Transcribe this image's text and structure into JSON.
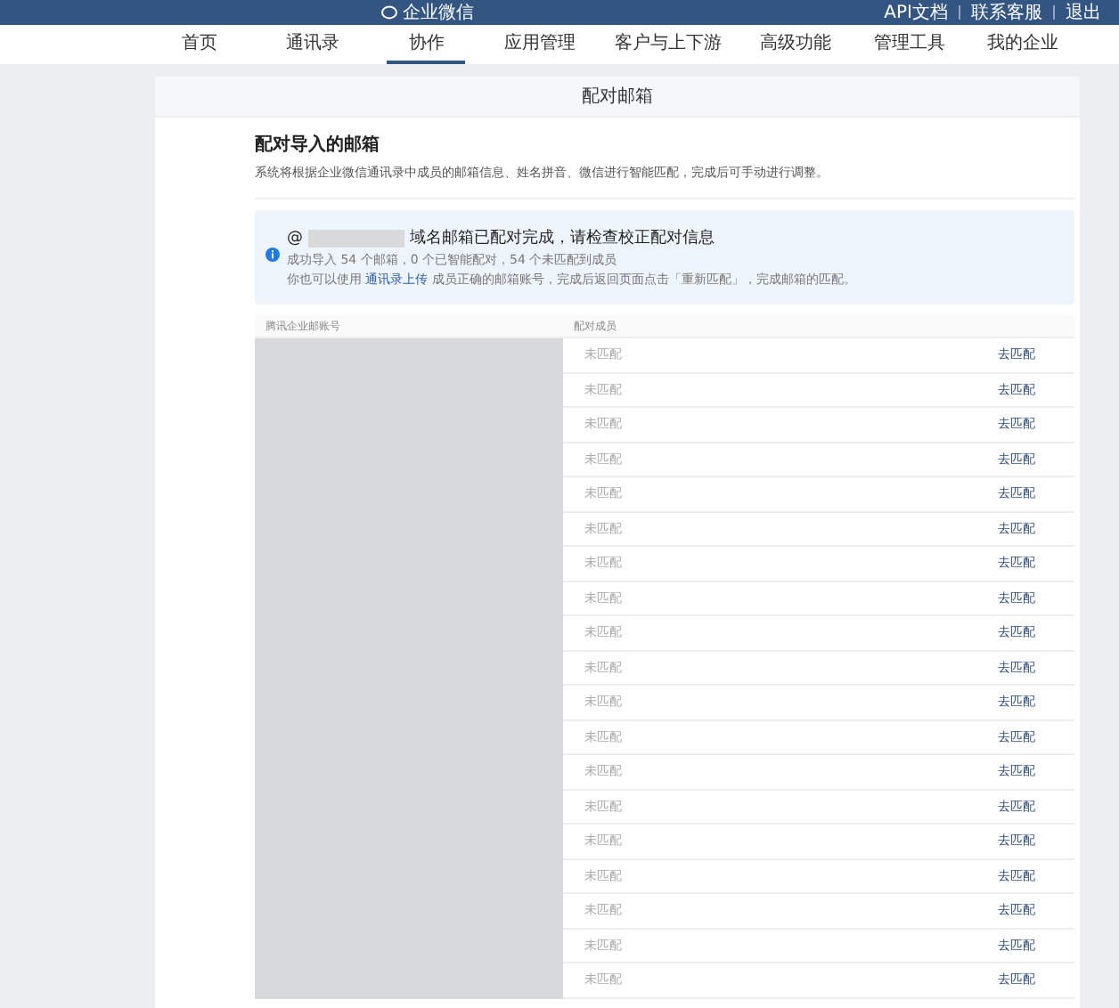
{
  "top_bar": {
    "logo": "企业微信",
    "links": [
      "API文档",
      "联系客服",
      "退出"
    ]
  },
  "nav": [
    {
      "label": "首页",
      "selected": false
    },
    {
      "label": "通讯录",
      "selected": false
    },
    {
      "label": "协作",
      "selected": true
    },
    {
      "label": "应用管理",
      "selected": false
    },
    {
      "label": "客户与上下游",
      "selected": false
    },
    {
      "label": "高级功能",
      "selected": false
    },
    {
      "label": "管理工具",
      "selected": false
    },
    {
      "label": "我的企业",
      "selected": false
    }
  ],
  "card": {
    "title": "配对邮箱",
    "heading": "配对导入的邮箱",
    "description": "系统将根据企业微信通讯录中成员的邮箱信息、姓名拼音、微信进行智能匹配，完成后可手动进行调整。"
  },
  "notice": {
    "prefix": "@",
    "title": "域名邮箱已配对完成，请检查校正配对信息",
    "summary": "成功导入 54 个邮箱，0 个已智能配对，54 个未匹配到成员",
    "hint_before": "你也可以使用",
    "hint_link": "通讯录上传",
    "hint_after": "成员正确的邮箱账号，完成后返回页面点击「重新匹配」，完成邮箱的匹配。"
  },
  "table": {
    "columns": [
      "腾讯企业邮账号",
      "配对成员"
    ],
    "rows": [
      {
        "status": "未匹配",
        "action": "去匹配"
      },
      {
        "status": "未匹配",
        "action": "去匹配"
      },
      {
        "status": "未匹配",
        "action": "去匹配"
      },
      {
        "status": "未匹配",
        "action": "去匹配"
      },
      {
        "status": "未匹配",
        "action": "去匹配"
      },
      {
        "status": "未匹配",
        "action": "去匹配"
      },
      {
        "status": "未匹配",
        "action": "去匹配"
      },
      {
        "status": "未匹配",
        "action": "去匹配"
      },
      {
        "status": "未匹配",
        "action": "去匹配"
      },
      {
        "status": "未匹配",
        "action": "去匹配"
      },
      {
        "status": "未匹配",
        "action": "去匹配"
      },
      {
        "status": "未匹配",
        "action": "去匹配"
      },
      {
        "status": "未匹配",
        "action": "去匹配"
      },
      {
        "status": "未匹配",
        "action": "去匹配"
      },
      {
        "status": "未匹配",
        "action": "去匹配"
      },
      {
        "status": "未匹配",
        "action": "去匹配"
      },
      {
        "status": "未匹配",
        "action": "去匹配"
      },
      {
        "status": "未匹配",
        "action": "去匹配"
      },
      {
        "status": "未匹配",
        "action": "去匹配"
      }
    ]
  }
}
